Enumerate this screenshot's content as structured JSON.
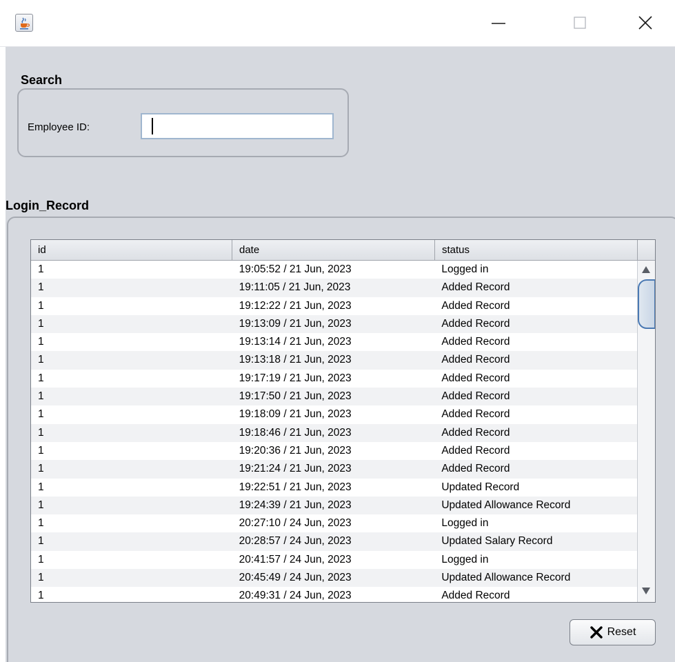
{
  "window": {
    "app_icon": "java-cup-icon",
    "controls": [
      "minimize-icon",
      "maximize-icon",
      "close-icon"
    ]
  },
  "search": {
    "title": "Search",
    "employee_label": "Employee ID:",
    "employee_value": ""
  },
  "records": {
    "title": "Login_Record",
    "columns": [
      "id",
      "date",
      "status"
    ],
    "rows": [
      [
        "1",
        "19:05:52 / 21 Jun, 2023",
        "Logged in"
      ],
      [
        "1",
        "19:11:05 / 21 Jun, 2023",
        "Added Record"
      ],
      [
        "1",
        "19:12:22 / 21 Jun, 2023",
        "Added Record"
      ],
      [
        "1",
        "19:13:09 / 21 Jun, 2023",
        "Added Record"
      ],
      [
        "1",
        "19:13:14 / 21 Jun, 2023",
        "Added Record"
      ],
      [
        "1",
        "19:13:18 / 21 Jun, 2023",
        "Added Record"
      ],
      [
        "1",
        "19:17:19 / 21 Jun, 2023",
        "Added Record"
      ],
      [
        "1",
        "19:17:50 / 21 Jun, 2023",
        "Added Record"
      ],
      [
        "1",
        "19:18:09 / 21 Jun, 2023",
        "Added Record"
      ],
      [
        "1",
        "19:18:46 / 21 Jun, 2023",
        "Added Record"
      ],
      [
        "1",
        "19:20:36 / 21 Jun, 2023",
        "Added Record"
      ],
      [
        "1",
        "19:21:24 / 21 Jun, 2023",
        "Added Record"
      ],
      [
        "1",
        "19:22:51 / 21 Jun, 2023",
        "Updated Record"
      ],
      [
        "1",
        "19:24:39 / 21 Jun, 2023",
        "Updated Allowance Record"
      ],
      [
        "1",
        "20:27:10 / 24 Jun, 2023",
        "Logged in"
      ],
      [
        "1",
        "20:28:57 / 24 Jun, 2023",
        "Updated Salary Record"
      ],
      [
        "1",
        "20:41:57 / 24 Jun, 2023",
        "Logged in"
      ],
      [
        "1",
        "20:45:49 / 24 Jun, 2023",
        "Updated Allowance Record"
      ],
      [
        "1",
        "20:49:31 / 24 Jun, 2023",
        "Added Record"
      ]
    ]
  },
  "actions": {
    "reset_label": "Reset",
    "reset_icon": "x-icon"
  },
  "colors": {
    "panel_bg": "#d6d9df",
    "focus_border": "#9fb6cf",
    "scroll_thumb_border": "#4a79b3"
  }
}
